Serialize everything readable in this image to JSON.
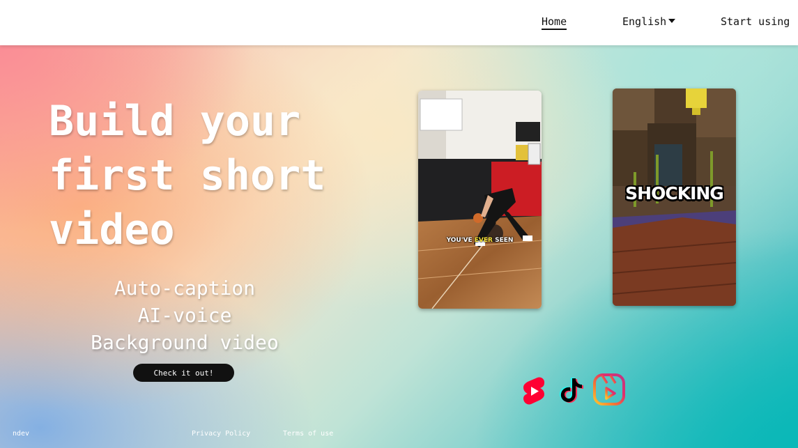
{
  "nav": {
    "home_label": "Home",
    "language_label": "English",
    "start_label": "Start using"
  },
  "hero": {
    "headline": [
      "Build your",
      "first short",
      "video"
    ],
    "features": [
      "Auto-caption",
      "AI-voice",
      "Background video"
    ],
    "cta_label": "Check it out!"
  },
  "previews": [
    {
      "caption_pre": "YOU'VE ",
      "caption_highlight": "EVER",
      "caption_post": " SEEN",
      "scene": "basketball-court"
    },
    {
      "caption": "SHOCKING",
      "scene": "minecraft-cave"
    }
  ],
  "social_icons": [
    "youtube-shorts-icon",
    "tiktok-icon",
    "instagram-reels-icon"
  ],
  "footer": {
    "brand": "ndev",
    "privacy_label": "Privacy Policy",
    "terms_label": "Terms of use"
  },
  "colors": {
    "cta_bg": "#111111",
    "youtube_red": "#ff0033",
    "caption_highlight": "#f6e23a"
  }
}
